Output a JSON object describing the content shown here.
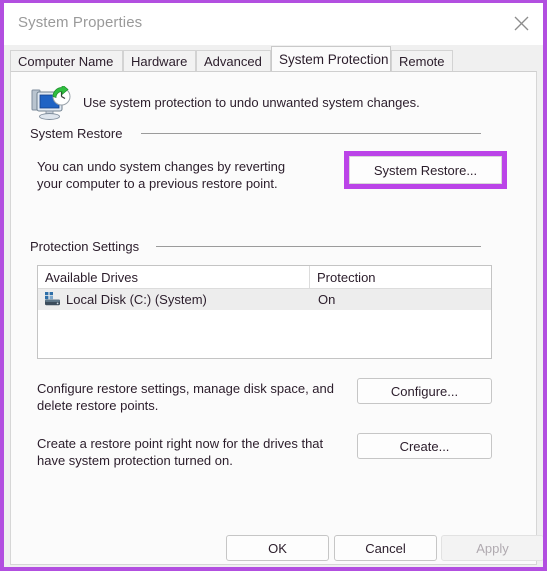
{
  "window": {
    "title": "System Properties",
    "close_icon": "close-icon",
    "border_color": "#b24fe0"
  },
  "tabs": [
    {
      "label": "Computer Name",
      "active": false
    },
    {
      "label": "Hardware",
      "active": false
    },
    {
      "label": "Advanced",
      "active": false
    },
    {
      "label": "System Protection",
      "active": true
    },
    {
      "label": "Remote",
      "active": false
    }
  ],
  "intro": {
    "icon": "system-protection-icon",
    "text": "Use system protection to undo unwanted system changes."
  },
  "system_restore": {
    "group_label": "System Restore",
    "description_line1": "You can undo system changes by reverting",
    "description_line2": "your computer to a previous restore point.",
    "button_label": "System Restore...",
    "highlight_color": "#bb44e8"
  },
  "protection_settings": {
    "group_label": "Protection Settings",
    "table": {
      "columns": [
        "Available Drives",
        "Protection"
      ],
      "rows": [
        {
          "drive": "Local Disk (C:) (System)",
          "drive_icon": "hard-drive-icon",
          "protection": "On"
        }
      ]
    },
    "configure": {
      "description_line1": "Configure restore settings, manage disk space, and",
      "description_line2": "delete restore points.",
      "button_label": "Configure..."
    },
    "create": {
      "description_line1": "Create a restore point right now for the drives that",
      "description_line2": "have system protection turned on.",
      "button_label": "Create..."
    }
  },
  "footer": {
    "ok_label": "OK",
    "cancel_label": "Cancel",
    "apply_label": "Apply",
    "apply_disabled": true
  }
}
